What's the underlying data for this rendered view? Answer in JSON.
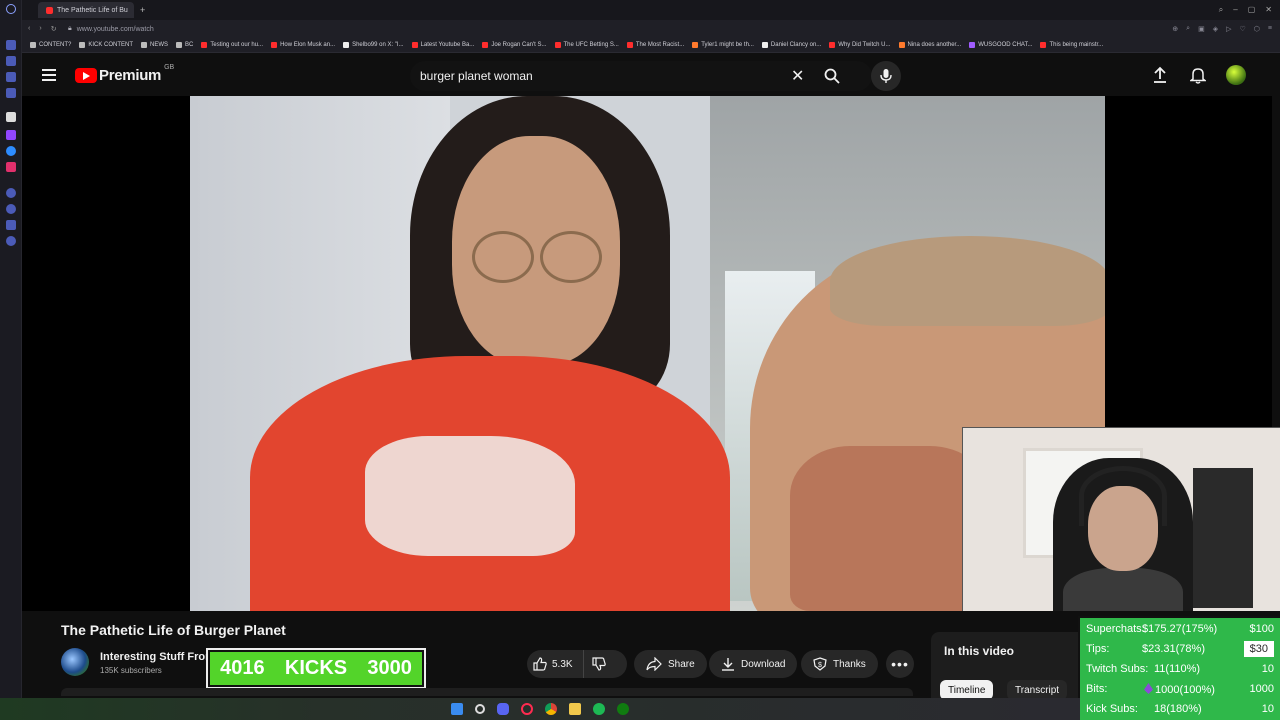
{
  "browser": {
    "tab_title": "The Pathetic Life of Bu",
    "new_tab": "+",
    "url": "www.youtube.com/watch",
    "bookmarks": [
      {
        "label": "CONTENT?",
        "color": "#bbbbbb"
      },
      {
        "label": "KICK CONTENT",
        "color": "#bbbbbb"
      },
      {
        "label": "NEWS",
        "color": "#bbbbbb"
      },
      {
        "label": "BC",
        "color": "#bbbbbb"
      },
      {
        "label": "Testing out our hu...",
        "color": "#ff2d2d"
      },
      {
        "label": "How Elon Musk an...",
        "color": "#ff2d2d"
      },
      {
        "label": "Shelbo99 on X: \"I...",
        "color": "#eeeeee"
      },
      {
        "label": "Latest Youtube Ba...",
        "color": "#ff2d2d"
      },
      {
        "label": "Joe Rogan Can't S...",
        "color": "#ff2d2d"
      },
      {
        "label": "The UFC Betting S...",
        "color": "#ff2d2d"
      },
      {
        "label": "The Most Racist...",
        "color": "#ff2d2d"
      },
      {
        "label": "Tyler1 might be th...",
        "color": "#ff7a2d"
      },
      {
        "label": "Daniel Clancy on...",
        "color": "#eeeeee"
      },
      {
        "label": "Why Did Twitch U...",
        "color": "#ff2d2d"
      },
      {
        "label": "Nina does another...",
        "color": "#ff7a2d"
      },
      {
        "label": "WUSGOOD CHAT...",
        "color": "#a05cff"
      },
      {
        "label": "This being mainstr...",
        "color": "#ff2d2d"
      }
    ]
  },
  "header": {
    "logo_text": "Premium",
    "country_code": "GB",
    "search_value": "burger planet woman"
  },
  "video": {
    "title": "The Pathetic Life of Burger Planet",
    "channel_name": "Interesting Stuff From",
    "subscribers": "135K subscribers",
    "likes": "5.3K",
    "share_label": "Share",
    "download_label": "Download",
    "thanks_label": "Thanks"
  },
  "kicks_banner": {
    "current": "4016",
    "label": "KICKS",
    "goal": "3000"
  },
  "in_this_video": {
    "title": "In this video",
    "tabs": [
      "Timeline",
      "Transcript"
    ]
  },
  "goals": [
    {
      "label": "Superchats:",
      "value": "$175.27(175%)",
      "target": "$100"
    },
    {
      "label": "Tips:",
      "value": "$23.31(78%)",
      "target": "$30"
    },
    {
      "label": "Twitch Subs:",
      "value": "11(110%)",
      "target": "10"
    },
    {
      "label": "Bits:",
      "value": "1000(100%)",
      "target": "1000"
    },
    {
      "label": "Kick Subs:",
      "value": "18(180%)",
      "target": "10"
    }
  ],
  "colors": {
    "yt_red": "#ff0000",
    "kicks_green": "#53d42a",
    "goals_green": "#2fb84a"
  }
}
